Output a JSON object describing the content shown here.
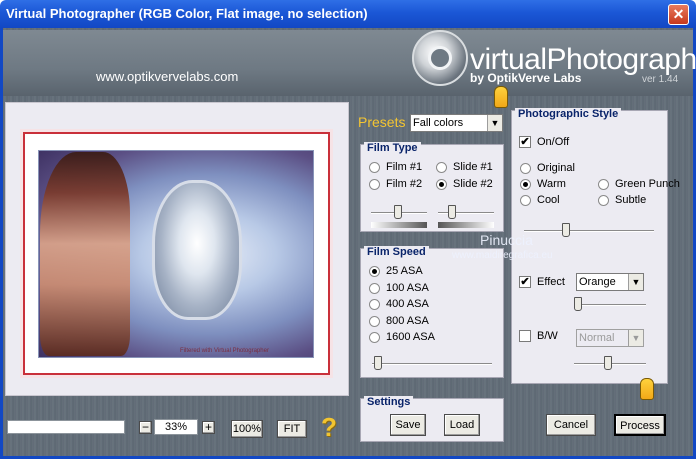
{
  "window": {
    "title": "Virtual Photographer (RGB Color, Flat image, no selection)",
    "close_label": "✕"
  },
  "header": {
    "website": "www.optikvervelabs.com",
    "brand_name": "virtualPhotographer",
    "brand_by": "by OptikVerve Labs",
    "version": "ver 1.44"
  },
  "preview": {
    "caption": "Filtered with Virtual Photographer"
  },
  "zoom": {
    "minus": "−",
    "value": "33%",
    "plus": "+",
    "btn_100": "100%",
    "btn_fit": "FIT",
    "help": "?"
  },
  "presets": {
    "label": "Presets",
    "selected": "Fall colors"
  },
  "film_type": {
    "legend": "Film Type",
    "options": [
      {
        "label": "Film #1",
        "checked": false
      },
      {
        "label": "Slide #1",
        "checked": false
      },
      {
        "label": "Film #2",
        "checked": false
      },
      {
        "label": "Slide #2",
        "checked": true
      }
    ]
  },
  "film_speed": {
    "legend": "Film Speed",
    "options": [
      {
        "label": "25 ASA",
        "checked": true
      },
      {
        "label": "100 ASA",
        "checked": false
      },
      {
        "label": "400 ASA",
        "checked": false
      },
      {
        "label": "800 ASA",
        "checked": false
      },
      {
        "label": "1600 ASA",
        "checked": false
      }
    ]
  },
  "settings": {
    "legend": "Settings",
    "save": "Save",
    "load": "Load"
  },
  "photographic_style": {
    "legend": "Photographic Style",
    "onoff": "On/Off",
    "onoff_checked": true,
    "options": [
      {
        "label": "Original",
        "checked": false
      },
      {
        "label": "Warm",
        "checked": true
      },
      {
        "label": "Green Punch",
        "checked": false
      },
      {
        "label": "Cool",
        "checked": false
      },
      {
        "label": "Subtle",
        "checked": false
      }
    ],
    "effect_label": "Effect",
    "effect_checked": true,
    "effect_value": "Orange",
    "bw_label": "B/W",
    "bw_checked": false,
    "bw_value": "Normal"
  },
  "actions": {
    "cancel": "Cancel",
    "process": "Process"
  },
  "watermark": {
    "name": "Pinuccia",
    "site": "www.maidiregrafica.eu"
  },
  "colors": {
    "titlebar": "#1b57d6",
    "accent_yellow": "#f4c531",
    "panel_bg": "#ecebf2",
    "legend_text": "#0a246a"
  }
}
